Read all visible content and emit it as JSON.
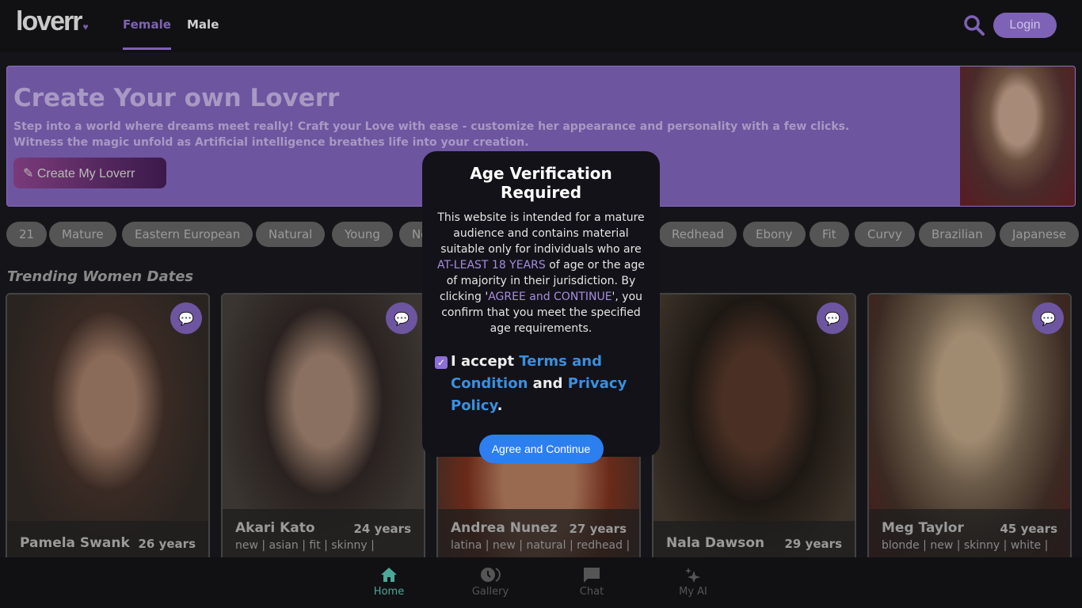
{
  "header": {
    "logo": "loverr",
    "tabs": [
      {
        "label": "Female",
        "active": true
      },
      {
        "label": "Male",
        "active": false
      }
    ],
    "login": "Login"
  },
  "banner": {
    "title": "Create Your own Loverr",
    "text1": "Step into a world where dreams meet really! Craft your Love with ease - customize her appearance and personality with a few clicks.",
    "text2": "Witness the magic unfold as Artificial intelligence breathes life into your creation.",
    "button": "Create My Loverr"
  },
  "chips": [
    "21",
    "Mature",
    "Eastern European",
    "Natural",
    "Young",
    "New",
    "Redhead",
    "Ebony",
    "Fit",
    "Curvy",
    "Brazilian",
    "Japanese"
  ],
  "section_title": "Trending Women Dates",
  "cards": [
    {
      "name": "Pamela Swank",
      "age": "26 years",
      "tags": ""
    },
    {
      "name": "Akari Kato",
      "age": "24 years",
      "tags": "new | asian | fit | skinny |"
    },
    {
      "name": "Andrea Nunez",
      "age": "27 years",
      "tags": "latina | new | natural | redhead |"
    },
    {
      "name": "Nala Dawson",
      "age": "29 years",
      "tags": ""
    },
    {
      "name": "Meg Taylor",
      "age": "45 years",
      "tags": "blonde | new | skinny | white |"
    }
  ],
  "modal": {
    "title": "Age Verification Required",
    "text_a": "This website is intended for a mature audience and contains material suitable only for individuals who are ",
    "highlight1": "AT-LEAST 18 YEARS",
    "text_b": " of age or the age of majority in their jurisdiction. By clicking '",
    "highlight2": "AGREE and CONTINUE",
    "text_c": "', you confirm that you meet the specified age requirements.",
    "accept_a": "I accept ",
    "terms": "Terms and Condition",
    "accept_b": " and ",
    "privacy": "Privacy Policy",
    "accept_c": ".",
    "checked": true,
    "button": "Agree and Continue"
  },
  "bottom_nav": [
    {
      "label": "Home",
      "active": true
    },
    {
      "label": "Gallery"
    },
    {
      "label": "Chat"
    },
    {
      "label": "My AI"
    }
  ],
  "colors": {
    "accent": "#7e62b5",
    "link": "#3a8fe0",
    "button": "#2d7ff0",
    "home_active": "#4aa89a"
  }
}
